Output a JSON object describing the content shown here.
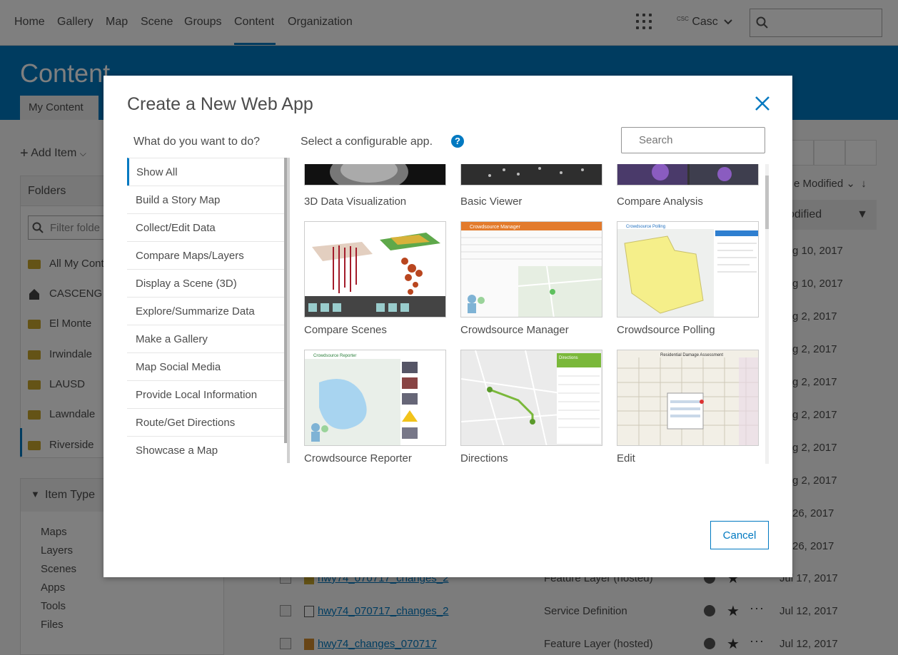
{
  "topnav": {
    "items": [
      "Home",
      "Gallery",
      "Map",
      "Scene",
      "Groups",
      "Content",
      "Organization"
    ],
    "user": "Casc",
    "user_badge": "CSC"
  },
  "banner": {
    "title": "Content",
    "tab": "My Content"
  },
  "sidebar": {
    "add_item": "Add Item",
    "folders_title": "Folders",
    "filter_placeholder": "Filter folde",
    "folders": [
      "All My Cont",
      "CASCENG",
      "El Monte",
      "Irwindale",
      "LAUSD",
      "Lawndale",
      "Riverside"
    ],
    "item_type_title": "Item Type",
    "item_types": [
      "Maps",
      "Layers",
      "Scenes",
      "Apps",
      "Tools",
      "Files"
    ],
    "bottom_partial": "Date Modified"
  },
  "list": {
    "sort_label": "e Modified",
    "column_header": "odified",
    "dates_partial": [
      "g 10, 2017",
      "g 10, 2017",
      "g 2, 2017",
      "g 2, 2017",
      "g 2, 2017",
      "g 2, 2017",
      "g 2, 2017",
      "g 2, 2017",
      "26, 2017",
      "26, 2017"
    ],
    "rows": [
      {
        "title": "hwy74_070717_changes_2",
        "type": "Feature Layer (hosted)",
        "date": "Jul 17, 2017"
      },
      {
        "title": "hwy74_070717_changes_2",
        "type": "Service Definition",
        "date": "Jul 12, 2017"
      },
      {
        "title": "hwy74_changes_070717",
        "type": "Feature Layer (hosted)",
        "date": "Jul 12, 2017"
      }
    ]
  },
  "modal": {
    "title": "Create a New Web App",
    "left_question": "What do you want to do?",
    "right_question": "Select a configurable app.",
    "help_glyph": "?",
    "search_placeholder": "Search",
    "categories": [
      "Show All",
      "Build a Story Map",
      "Collect/Edit Data",
      "Compare Maps/Layers",
      "Display a Scene (3D)",
      "Explore/Summarize Data",
      "Make a Gallery",
      "Map Social Media",
      "Provide Local Information",
      "Route/Get Directions",
      "Showcase a Map"
    ],
    "apps": [
      "3D Data Visualization",
      "Basic Viewer",
      "Compare Analysis",
      "Compare Scenes",
      "Crowdsource Manager",
      "Crowdsource Polling",
      "Crowdsource Reporter",
      "Directions",
      "Edit"
    ],
    "thumb_text": {
      "crowdsource_manager": "Crowdsource Manager",
      "crowdsource_polling": "Crowdsource Polling",
      "crowdsource_reporter": "Crowdsource Reporter",
      "directions": "Directions",
      "edit": "Residential Damage Assessment"
    },
    "cancel": "Cancel"
  },
  "colors": {
    "accent": "#0079c1",
    "banner": "#0079c1"
  }
}
